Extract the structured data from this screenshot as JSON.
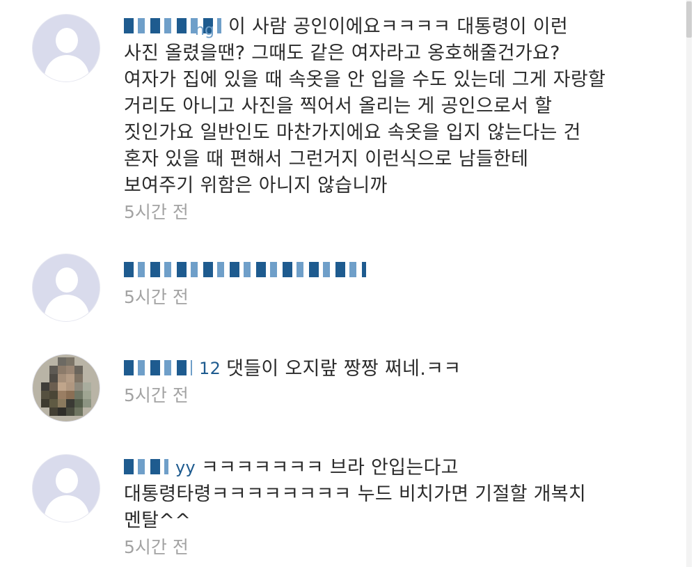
{
  "comments": [
    {
      "author_suffix": "ng",
      "lines": [
        "이 사람 공인이에요ㅋㅋㅋㅋ 대통령이 이런",
        "사진 올렸을땐? 그때도 같은 여자라고 옹호해줄건가요?",
        "여자가 집에 있을 때 속옷을 안 입을 수도 있는데 그게 자랑할",
        "거리도 아니고 사진을 찍어서 올리는 게 공인으로서 할",
        "짓인가요 일반인도 마찬가지에요 속옷을 입지 않는다는 건",
        "혼자 있을 때 편해서 그런거지 이런식으로 남들한테",
        "보여주기 위함은 아니지 않습니까"
      ],
      "time": "5시간 전"
    },
    {
      "author_suffix": "",
      "lines": [],
      "time": "5시간 전"
    },
    {
      "author_suffix": "12",
      "lines": [
        "댓들이  오지랖 짱짱 쩌네.ㅋㅋ"
      ],
      "time": "5시간 전"
    },
    {
      "author_suffix": "yy",
      "lines": [
        "ㅋㅋㅋㅋㅋㅋㅋ 브라 안입는다고",
        "대통령타령ㅋㅋㅋㅋㅋㅋㅋㅋ 누드 비치가면 기절할 개복치",
        "멘탈^^"
      ],
      "time": "5시간 전"
    }
  ]
}
